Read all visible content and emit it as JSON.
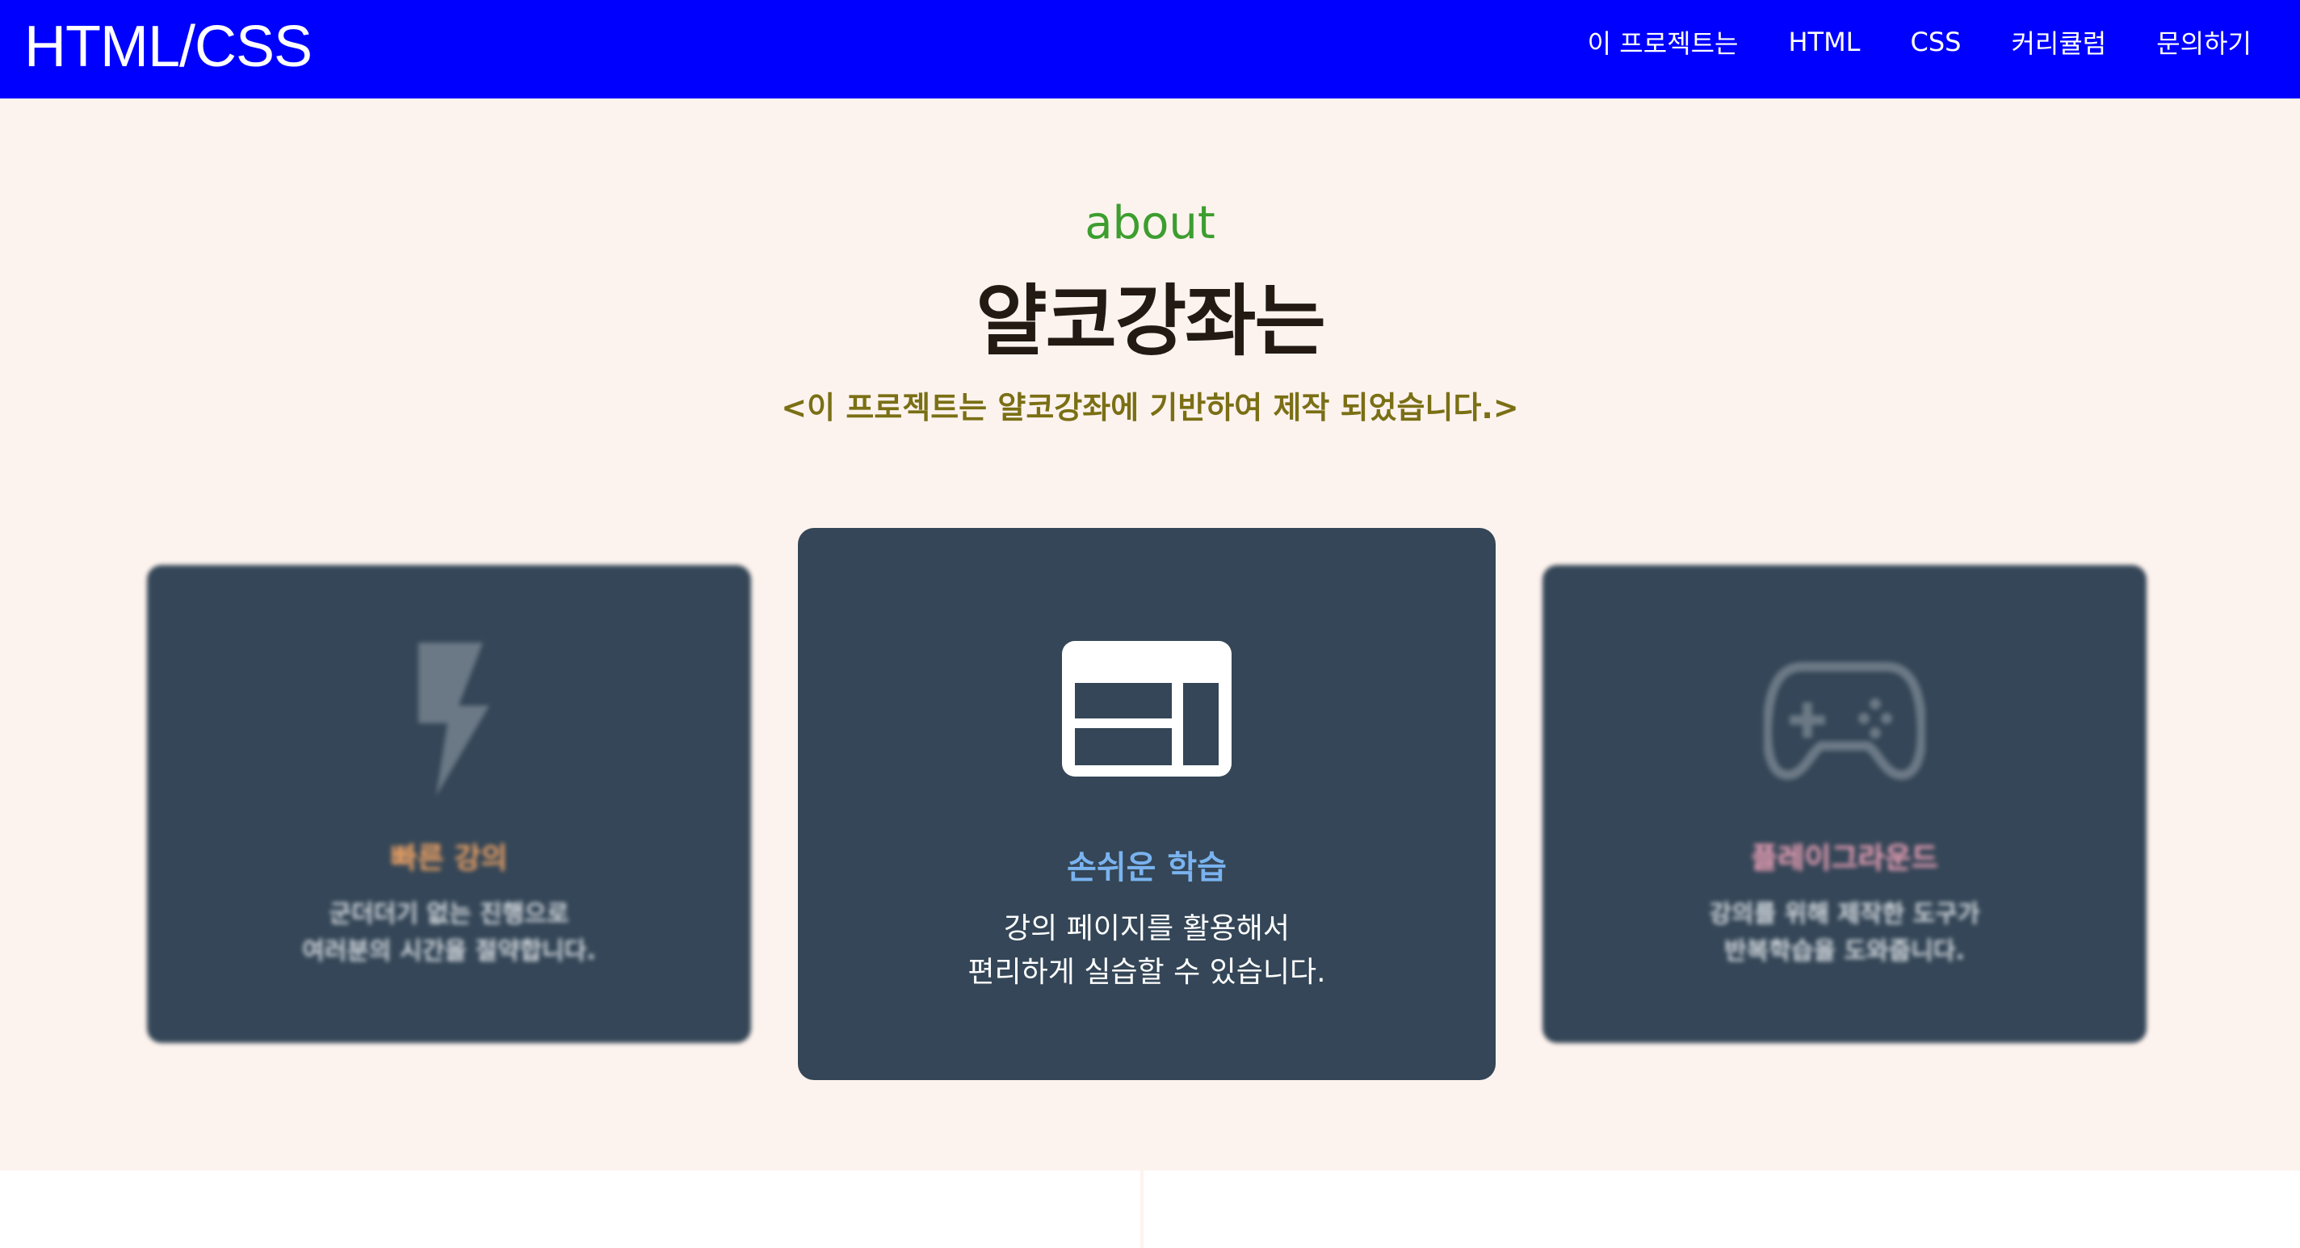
{
  "header": {
    "brand": "HTML/CSS",
    "nav": [
      "이 프로젝트는",
      "HTML",
      "CSS",
      "커리큘럼",
      "문의하기"
    ]
  },
  "about": {
    "label": "about",
    "title": "얄코강좌는",
    "subtitle": "<이 프로젝트는 얄코강좌에 기반하여 제작 되었습니다.>"
  },
  "cards": [
    {
      "icon": "lightning-icon",
      "title": "빠른 강의",
      "desc": "군더더기 없는 진행으로\n여러분의 시간을 절약합니다.",
      "title_color": "#f0a364"
    },
    {
      "icon": "layout-window-icon",
      "title": "손쉬운 학습",
      "desc": "강의 페이지를 활용해서\n편리하게 실습할 수 있습니다.",
      "title_color": "#7ab3ef"
    },
    {
      "icon": "gamepad-icon",
      "title": "플레이그라운드",
      "desc": "강의를 위해 제작한 도구가\n반복학습을 도와줍니다.",
      "title_color": "#f2a3b9"
    }
  ],
  "colors": {
    "nav_bg": "#0000ff",
    "section_bg": "#fdf3ee",
    "card_bg": "#344657",
    "about_label": "#3c9e2f",
    "subtitle": "#7a6f14"
  }
}
